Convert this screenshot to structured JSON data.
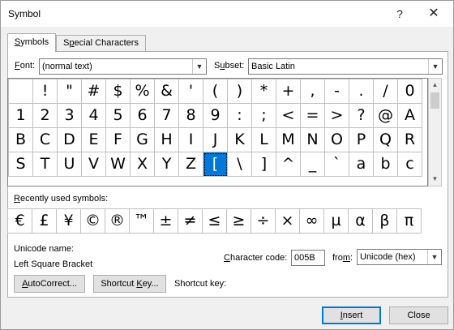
{
  "window": {
    "title": "Symbol",
    "help_label": "?",
    "close_label": "✕"
  },
  "tabs": [
    {
      "label_pre": "",
      "label_key": "S",
      "label_post": "ymbols"
    },
    {
      "label_pre": "S",
      "label_key": "p",
      "label_post": "ecial Characters"
    }
  ],
  "font": {
    "label_key": "F",
    "label_post": "ont:",
    "value": "(normal text)"
  },
  "subset": {
    "label_pre": "S",
    "label_key": "u",
    "label_post": "bset:",
    "value": "Basic Latin"
  },
  "symbol_grid": {
    "rows": [
      [
        " ",
        "!",
        "\"",
        "#",
        "$",
        "%",
        "&",
        "'",
        "(",
        ")",
        "*",
        "+",
        ",",
        "-",
        ".",
        "/",
        "0"
      ],
      [
        "1",
        "2",
        "3",
        "4",
        "5",
        "6",
        "7",
        "8",
        "9",
        ":",
        ";",
        "<",
        "=",
        ">",
        "?",
        "@",
        "A"
      ],
      [
        "B",
        "C",
        "D",
        "E",
        "F",
        "G",
        "H",
        "I",
        "J",
        "K",
        "L",
        "M",
        "N",
        "O",
        "P",
        "Q",
        "R"
      ],
      [
        "S",
        "T",
        "U",
        "V",
        "W",
        "X",
        "Y",
        "Z",
        "[",
        "\\",
        "]",
        "^",
        "_",
        "`",
        "a",
        "b",
        "c"
      ]
    ],
    "selected": "["
  },
  "recent": {
    "label_pre": "",
    "label_key": "R",
    "label_post": "ecently used symbols:",
    "symbols": [
      "€",
      "£",
      "¥",
      "©",
      "®",
      "™",
      "±",
      "≠",
      "≤",
      "≥",
      "÷",
      "×",
      "∞",
      "µ",
      "α",
      "β",
      "π"
    ]
  },
  "unicode": {
    "name_label": "Unicode name:",
    "name_value": "Left Square Bracket"
  },
  "character_code": {
    "label_pre": "",
    "label_key": "C",
    "label_post": "haracter code:",
    "value": "005B"
  },
  "from": {
    "label_pre": "fro",
    "label_key": "m",
    "label_post": ":",
    "value": "Unicode (hex)"
  },
  "buttons": {
    "autocorrect": {
      "pre": "",
      "key": "A",
      "post": "utoCorrect..."
    },
    "shortcut_key": {
      "pre": "Shortcut ",
      "key": "K",
      "post": "ey..."
    },
    "shortcut_key_label": "Shortcut key:",
    "insert": {
      "pre": "",
      "key": "I",
      "post": "nsert"
    },
    "close": "Close"
  },
  "icons": {
    "dropdown": "chevron-down-icon",
    "scroll_up": "scroll-up-icon",
    "scroll_down": "scroll-down-icon"
  }
}
